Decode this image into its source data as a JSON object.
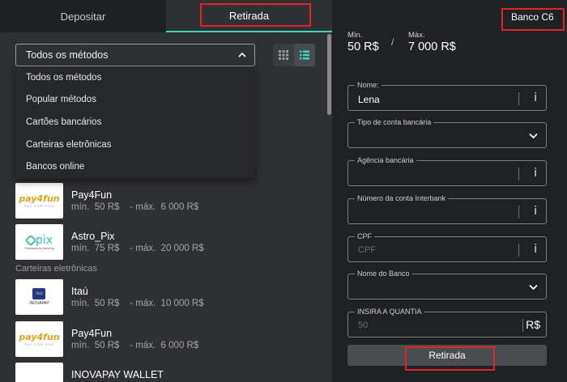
{
  "tabs": [
    {
      "label": "Depositar"
    },
    {
      "label": "Retirada"
    }
  ],
  "filter": {
    "selected": "Todos os métodos",
    "options": [
      "Todos os métodos",
      "Popular métodos",
      "Cartões bancários",
      "Carteiras eletrônicas",
      "Bancos online"
    ]
  },
  "methods_top": [
    {
      "name": "Pay4Fun",
      "range": "mín.  50 R$    - máx.  6 000 R$",
      "logo": "pay4fun"
    },
    {
      "name": "Astro_Pix",
      "range": "mín.  75 R$    - máx.  20 000 R$",
      "logo": "pix"
    }
  ],
  "section_ewallets": "Carteiras eletrônicas",
  "methods_ewallets": [
    {
      "name": "Itaú",
      "range": "mín.  50 R$    - máx.  10 000 R$",
      "logo": "itau"
    },
    {
      "name": "Pay4Fun",
      "range": "mín.  50 R$    - máx.  6 000 R$",
      "logo": "pay4fun"
    },
    {
      "name": "INOVAPAY WALLET",
      "range": "",
      "logo": "inovapay"
    }
  ],
  "logos": {
    "pay4fun_text": "pay4fun",
    "pay4fun_sub": "PAY FOR FUN",
    "pix_text": "pix",
    "pix_sub": "Processed by AstroPay",
    "itau_text": "Itaú",
    "inovapay_text": "INOVAPAY"
  },
  "right": {
    "bank_title": "Banco C6",
    "min_label": "Mín.",
    "min_value": "50 R$",
    "separator": "/",
    "max_label": "Máx.",
    "max_value": "7 000 R$",
    "fields": [
      {
        "label": "Nome:",
        "value": "Lena",
        "kind": "text-info"
      },
      {
        "label": "Tipo de conta bancária",
        "value": "",
        "kind": "select"
      },
      {
        "label": "Agência bancária",
        "value": "",
        "kind": "text-info"
      },
      {
        "label": "Número da conta Interbank",
        "value": "",
        "kind": "text-info"
      },
      {
        "label": "CPF",
        "placeholder": "CPF",
        "kind": "text-info"
      },
      {
        "label": "Nome do Banco",
        "value": "",
        "kind": "select"
      },
      {
        "label": "INSIRA A QUANTIA",
        "placeholder": "50",
        "currency": "R$",
        "kind": "amount"
      }
    ],
    "info_glyph": "i",
    "submit_label": "Retirada"
  },
  "colors": {
    "accent": "#3dd6b5",
    "highlight": "#e0232a",
    "pane_left": "#2f3033",
    "pane_right": "#202124"
  }
}
